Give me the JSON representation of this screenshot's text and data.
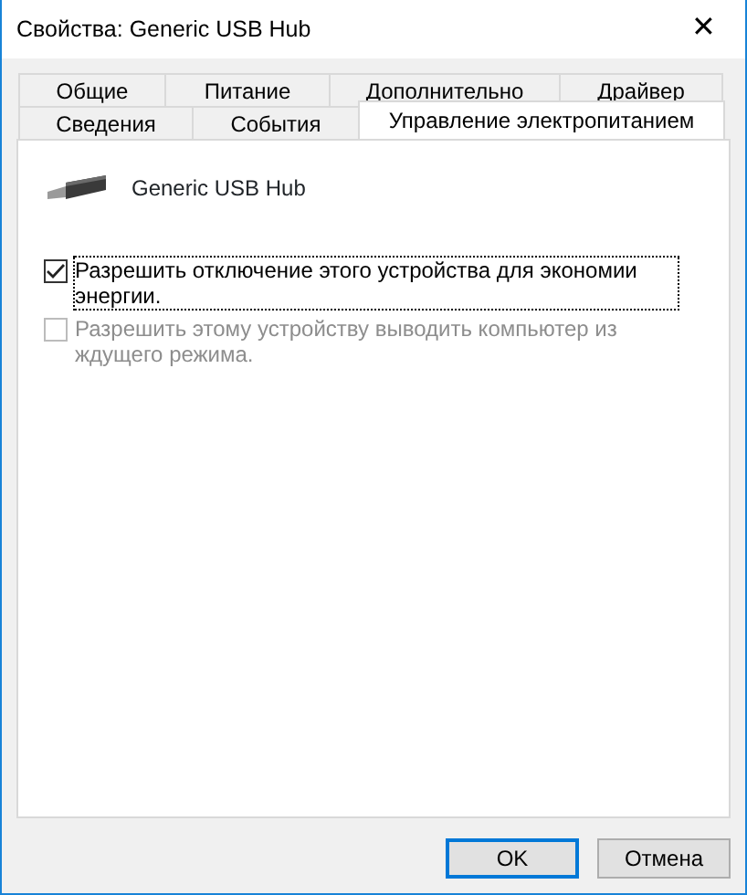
{
  "window": {
    "title": "Свойства: Generic USB Hub",
    "close": "✕"
  },
  "tab_rows": [
    {
      "tabs": [
        {
          "label": "Общие",
          "selected": false
        },
        {
          "label": "Питание",
          "selected": false
        },
        {
          "label": "Дополнительно",
          "selected": false
        },
        {
          "label": "Драйвер",
          "selected": false
        }
      ]
    },
    {
      "tabs": [
        {
          "label": "Сведения",
          "selected": false
        },
        {
          "label": "События",
          "selected": false
        },
        {
          "label": "Управление электропитанием",
          "selected": true
        }
      ]
    }
  ],
  "device": {
    "name": "Generic USB Hub"
  },
  "options": [
    {
      "label": "Разрешить отключение этого устройства для экономии энергии.",
      "checked": true,
      "disabled": false,
      "focused": true
    },
    {
      "label": "Разрешить этому устройству выводить компьютер из ждущего режима.",
      "checked": false,
      "disabled": true,
      "focused": false
    }
  ],
  "buttons": [
    {
      "label": "OK",
      "default": true
    },
    {
      "label": "Отмена",
      "default": false
    }
  ]
}
